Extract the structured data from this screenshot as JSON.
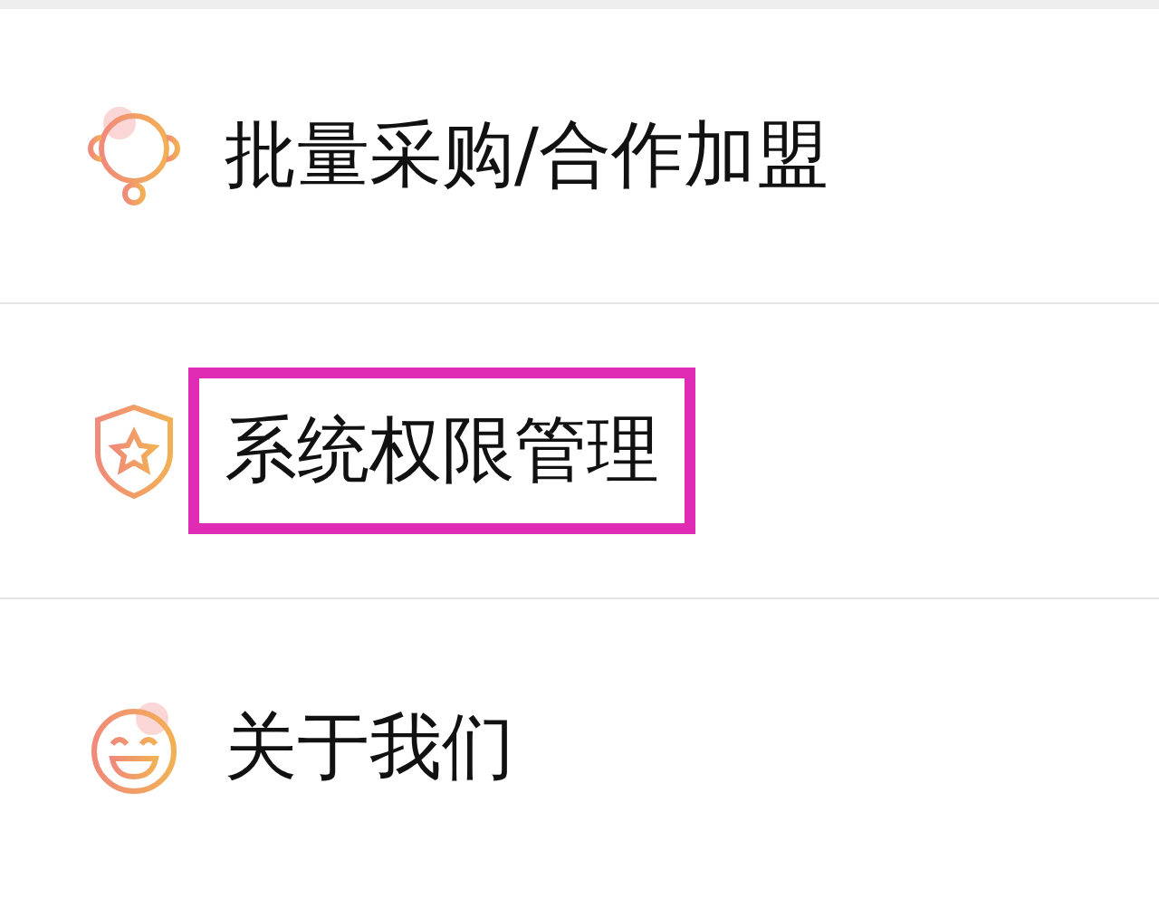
{
  "menu": [
    {
      "kind": "headset",
      "label": "批量采购/合作加盟",
      "highlighted": false
    },
    {
      "kind": "shield",
      "label": "系统权限管理",
      "highlighted": true
    },
    {
      "kind": "smiley",
      "label": "关于我们",
      "highlighted": false
    }
  ]
}
